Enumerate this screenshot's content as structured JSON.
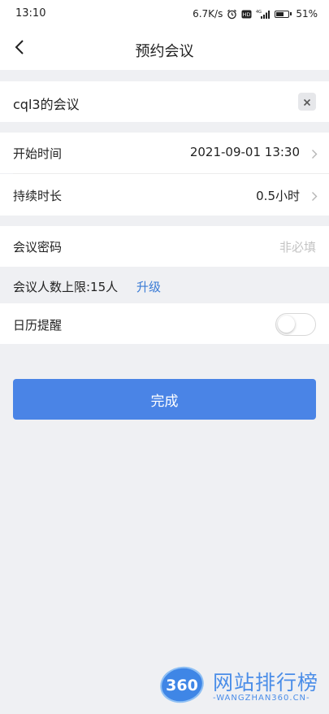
{
  "status_bar": {
    "time": "13:10",
    "network_speed": "6.7K/s",
    "battery_percent": "51%",
    "icons": [
      "alarm-icon",
      "hd-icon",
      "signal-4g-icon",
      "battery-icon"
    ]
  },
  "nav": {
    "title": "预约会议",
    "back_icon": "chevron-left-icon"
  },
  "meeting_title": {
    "value": "cql3的会议",
    "clear_icon": "close-icon"
  },
  "start_time": {
    "label": "开始时间",
    "value": "2021-09-01 13:30"
  },
  "duration": {
    "label": "持续时长",
    "value": "0.5小时"
  },
  "password": {
    "label": "会议密码",
    "placeholder": "非必填"
  },
  "participant_limit": {
    "label": "会议人数上限:15人",
    "upgrade_label": "升级"
  },
  "calendar_reminder": {
    "label": "日历提醒",
    "enabled": false
  },
  "done_button": {
    "label": "完成"
  },
  "watermark": {
    "logo_text": "360",
    "title": "网站排行榜",
    "subtitle": "-WANGZHAN360.CN-"
  },
  "colors": {
    "accent": "#4a84e6",
    "link": "#3a7bd5",
    "background": "#eff0f3",
    "watermark": "#4a8de8"
  }
}
